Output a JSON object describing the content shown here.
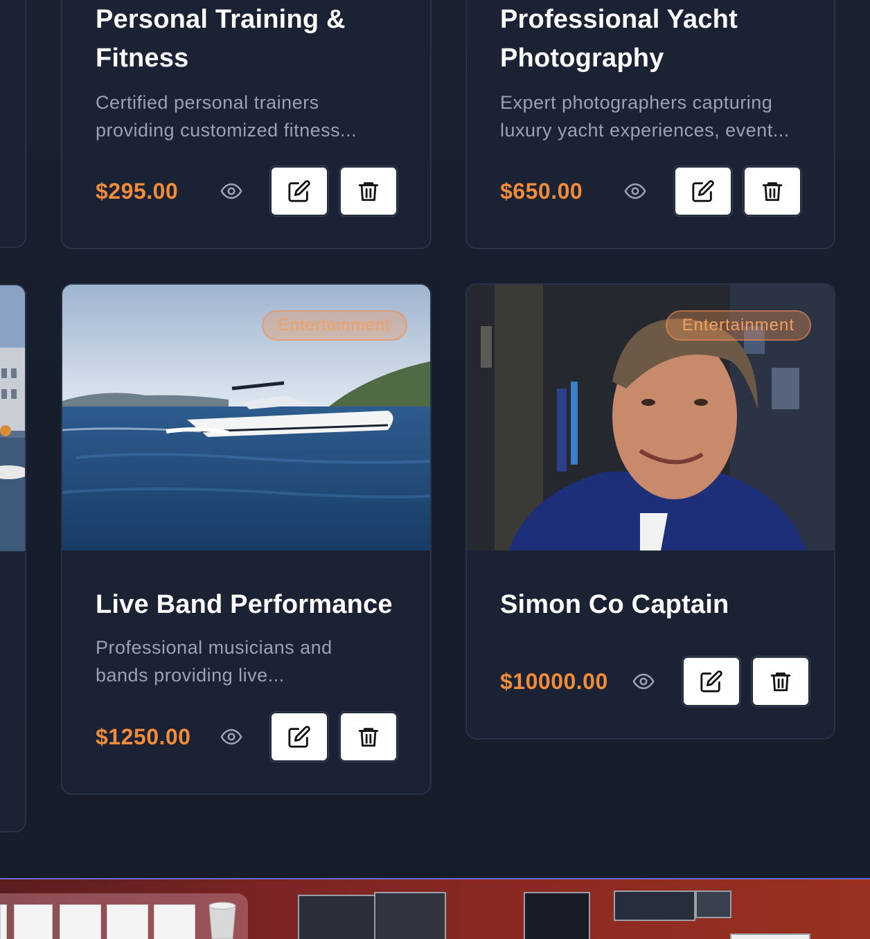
{
  "cards": [
    {
      "title": "Personal Training & Fitness",
      "description": "Certified personal trainers providing customized fitness...",
      "price": "$295.00"
    },
    {
      "title": "Professional Yacht Photography",
      "description": "Expert photographers capturing luxury yacht experiences, event...",
      "price": "$650.00"
    },
    {
      "title": "Live Band Performance",
      "description": "Professional musicians and bands providing live...",
      "price": "$1250.00",
      "badge": "Entertainment",
      "image": "speedboat-on-sea"
    },
    {
      "title": "Simon Co Captain",
      "description": "",
      "price": "$10000.00",
      "badge": "Entertainment",
      "image": "portrait-man-smiling"
    }
  ],
  "icons": {
    "view": "eye-icon",
    "edit": "edit-icon",
    "delete": "trash-icon"
  },
  "colors": {
    "price": "#f08c3a",
    "badge_text": "#f3a060",
    "card_bg": "#1a2233",
    "page_bg": "#161d2d"
  }
}
